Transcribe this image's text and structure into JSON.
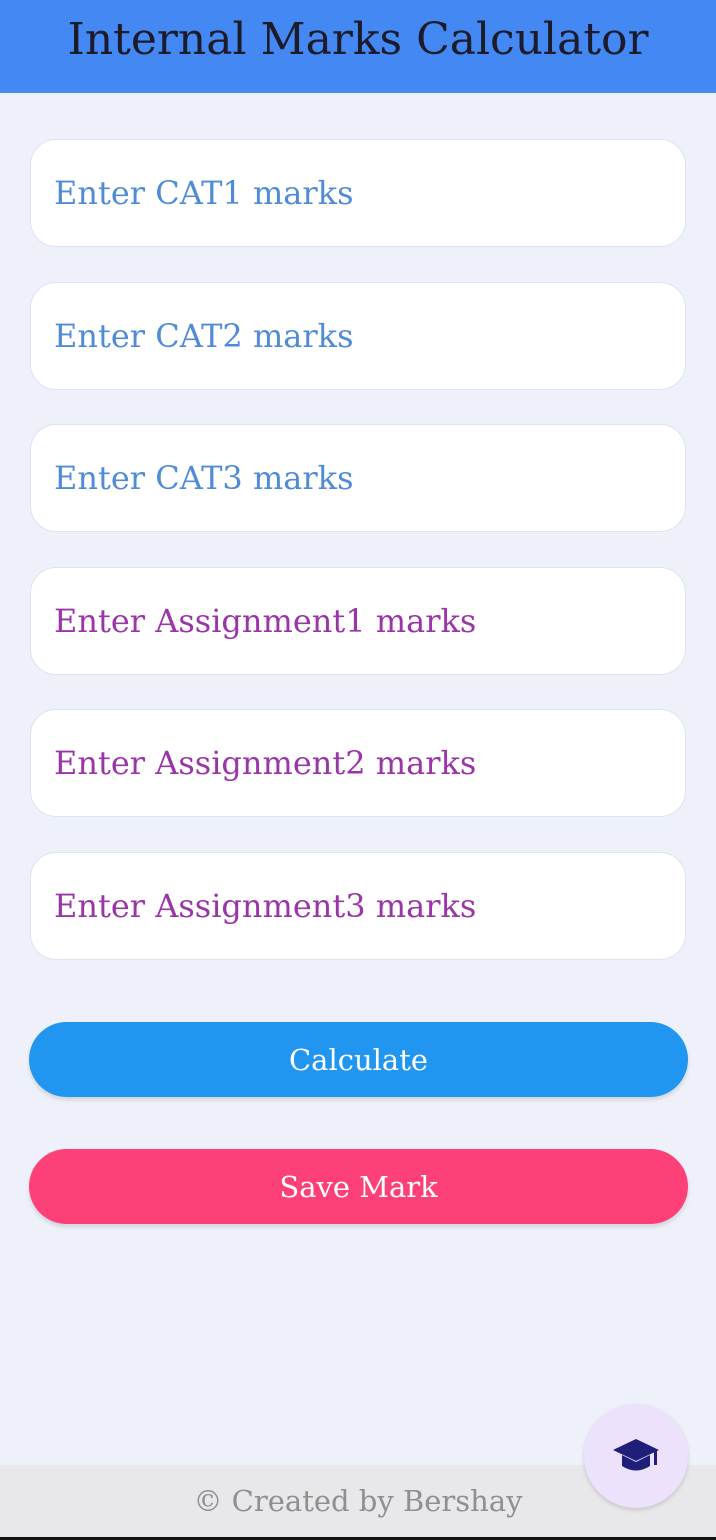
{
  "header": {
    "title": "Internal Marks Calculator",
    "background_color": "#4488f4"
  },
  "fields": [
    {
      "placeholder": "Enter CAT1 marks",
      "value": ""
    },
    {
      "placeholder": "Enter CAT2 marks",
      "value": ""
    },
    {
      "placeholder": "Enter CAT3 marks",
      "value": ""
    },
    {
      "placeholder": "Enter Assignment1 marks",
      "value": ""
    },
    {
      "placeholder": "Enter Assignment2 marks",
      "value": ""
    },
    {
      "placeholder": "Enter Assignment3 marks",
      "value": ""
    }
  ],
  "colors": {
    "cat_placeholder": "#4f8bd6",
    "assignment_placeholder": "#9a35a8",
    "calculate_button": "#2196f0",
    "save_button": "#fd4078",
    "page_background": "#eef1f9"
  },
  "buttons": {
    "calculate_label": "Calculate",
    "save_label": "Save Mark"
  },
  "fab": {
    "icon": "graduation-cap-icon"
  },
  "footer": {
    "text": "© Created by Bershay"
  }
}
